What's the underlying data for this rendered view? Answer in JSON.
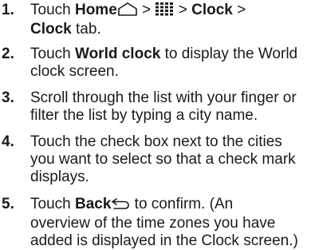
{
  "steps": [
    {
      "number": "1.",
      "lines": [
        {
          "prefix": "Touch ",
          "home_bold": "Home",
          "sep1": " > ",
          "sep2": " > ",
          "clock_bold": "Clock",
          "sep3": " >"
        },
        {
          "bold": "Clock",
          "rest": " tab."
        }
      ],
      "icons": [
        "home-icon",
        "apps-grid-icon"
      ]
    },
    {
      "number": "2.",
      "lines": [
        {
          "prefix": "Touch ",
          "bold": "World clock",
          "rest": " to display the World"
        },
        {
          "text": "clock screen."
        }
      ]
    },
    {
      "number": "3.",
      "lines": [
        {
          "text": "Scroll through the list with your finger or"
        },
        {
          "text": "filter the list by typing a city name."
        }
      ]
    },
    {
      "number": "4.",
      "lines": [
        {
          "text": "Touch the check box next to the cities"
        },
        {
          "text": "you want to select so that a check mark"
        },
        {
          "text": "displays."
        }
      ]
    },
    {
      "number": "5.",
      "lines": [
        {
          "prefix": "Touch ",
          "bold": "Back",
          "rest": " to confirm. (An"
        },
        {
          "text": "overview of the time zones you have"
        },
        {
          "text": "added is displayed in the Clock screen.)"
        }
      ],
      "icons": [
        "back-arrow-icon"
      ]
    }
  ]
}
